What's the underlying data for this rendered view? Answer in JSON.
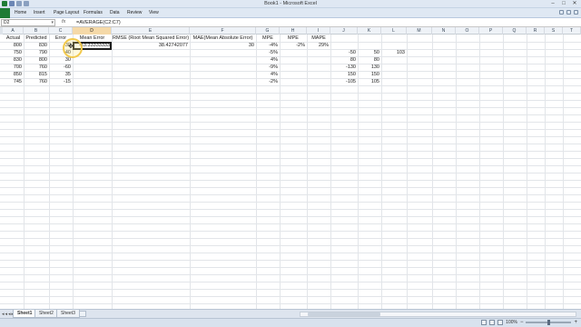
{
  "window": {
    "title": "Book1 - Microsoft Excel",
    "controls": [
      "–",
      "□",
      "✕"
    ]
  },
  "ribbon": {
    "file_color": "#1e7b35",
    "tabs": [
      "Home",
      "Insert",
      "Page Layout",
      "Formulas",
      "Data",
      "Review",
      "View"
    ]
  },
  "formula_bar": {
    "name_box": "D2",
    "fx": "fx",
    "formula": "=AVERAGE(C2:C7)"
  },
  "columns": [
    "A",
    "B",
    "C",
    "D",
    "E",
    "F",
    "G",
    "H",
    "I",
    "J",
    "K",
    "L",
    "M",
    "N",
    "O",
    "P",
    "Q",
    "R",
    "S",
    "T"
  ],
  "selected_column": "D",
  "cells": {
    "A1": "Actual",
    "B1": "Predicted",
    "C1": "Error",
    "D1": "Mean Error",
    "E1": "RMSE (Root Mean Squared Error)",
    "F1": "MAE(Mean Absolute Error)",
    "G1": "MPE",
    "H1": "MPE",
    "I1": "MAPE",
    "A2": "800",
    "B2": "830",
    "C2": "-30",
    "D2": "-13.33333333",
    "E2": "38.42742077",
    "F2": "30",
    "G2": "-4%",
    "H2": "-2%",
    "I2": "29%",
    "A3": "750",
    "B3": "790",
    "C3": "-40",
    "G3": "-5%",
    "J3": "-50",
    "K3": "50",
    "L3": "103",
    "A4": "830",
    "B4": "800",
    "C4": "30",
    "G4": "4%",
    "J4": "80",
    "K4": "80",
    "A5": "700",
    "B5": "760",
    "C5": "-60",
    "G5": "-9%",
    "J5": "-130",
    "K5": "130",
    "A6": "850",
    "B6": "815",
    "C6": "35",
    "G6": "4%",
    "J6": "150",
    "K6": "150",
    "A7": "745",
    "B7": "760",
    "C7": "-15",
    "G7": "-2%",
    "J7": "-105",
    "K7": "105"
  },
  "sheets": [
    "Sheet1",
    "Sheet2",
    "Sheet3"
  ],
  "active_sheet": "Sheet1",
  "status": {
    "zoom": "100%",
    "minus": "−",
    "plus": "+"
  },
  "colors": {
    "selected_header": "#f5d9a8",
    "cursor_highlight": "#f2c94c"
  }
}
